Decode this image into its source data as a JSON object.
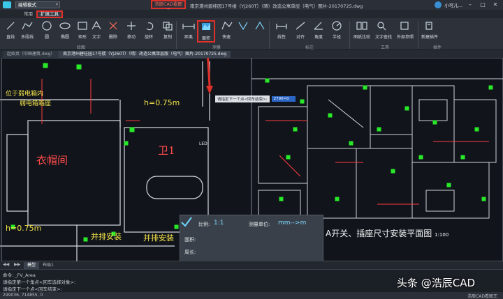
{
  "titlebar": {
    "mode": "编辑模式",
    "highlight": "浩辰CAD看图王",
    "document_title": "南京港州碧桂园17号楼（YJ260T）（晴）改造公寓单层（电气）图片-20170725.dwg",
    "user": "小可儿..."
  },
  "tabs": [
    {
      "label": "常用"
    },
    {
      "label": "扩展工具"
    }
  ],
  "ribbon": {
    "buttons": [
      {
        "label": "直线",
        "icon": "line-icon"
      },
      {
        "label": "多段线",
        "icon": "polyline-icon"
      },
      {
        "label": "圆",
        "icon": "circle-icon"
      },
      {
        "label": "椭圆",
        "icon": "ellipse-icon"
      },
      {
        "label": "矩形",
        "icon": "rectangle-icon"
      },
      {
        "label": "文字",
        "icon": "text-icon"
      },
      {
        "label": "删除",
        "icon": "delete-icon"
      },
      {
        "label": "移动",
        "icon": "move-icon"
      },
      {
        "label": "旋转",
        "icon": "rotate-icon"
      },
      {
        "label": "复制",
        "icon": "copy-icon"
      },
      {
        "label": "距离",
        "icon": "distance-icon"
      },
      {
        "label": "面积",
        "icon": "area-icon"
      },
      {
        "label": "快速",
        "icon": "quick-icon"
      },
      {
        "label": "线性",
        "icon": "linear-dim-icon"
      },
      {
        "label": "对齐",
        "icon": "aligned-dim-icon"
      },
      {
        "label": "角度",
        "icon": "angle-dim-icon"
      },
      {
        "label": "半径",
        "icon": "radius-dim-icon"
      },
      {
        "label": "图纸比较",
        "icon": "compare-icon"
      },
      {
        "label": "文字查找",
        "icon": "text-search-icon"
      },
      {
        "label": "外部参照",
        "icon": "xref-icon"
      },
      {
        "label": "新建插件",
        "icon": "plugin-icon"
      }
    ],
    "groups": [
      {
        "label": "绘图"
      },
      {
        "label": "测量"
      },
      {
        "label": "标注"
      },
      {
        "label": "工具"
      },
      {
        "label": "插件"
      }
    ]
  },
  "doc_tabs": [
    {
      "label": "起始页（中国建筑.dwg）"
    },
    {
      "label": "南京港州碧桂园17号楼（YJ260T）（晴）改造公寓单层版（电气）图片-20170725.dwg"
    }
  ],
  "drawing": {
    "rooms": [
      {
        "label": "衣帽间"
      },
      {
        "label": "卫1"
      }
    ],
    "texts": [
      "位于弱电箱内",
      "弱电箱箱座",
      "h=0.75m",
      "h=0.75m",
      "并排安装",
      "并排安装",
      "LED"
    ],
    "prompt": {
      "text": "请指定下一个点<回车结束>:",
      "value": "2790=0"
    },
    "measure": {
      "scale_label": "比例:",
      "scale_value": "1:1",
      "unit_label": "测量单位:",
      "unit_value": "mm-->m",
      "area_label": "面积:",
      "perimeter_label": "周长:"
    },
    "plan_title": "A开关、插座尺寸安装平面图",
    "plan_scale": "1:100"
  },
  "layout_tabs": [
    {
      "label": "模型"
    },
    {
      "label": "布局1"
    }
  ],
  "command": {
    "lines": [
      "命令: _FV_Area",
      "请指定第一个角点<回车选择对象>:",
      "请指定下一个点<回车结束>:"
    ]
  },
  "status": {
    "coords": "299036, 714855, 0",
    "brand": "浩辰CAD看图王"
  },
  "watermark": "头条 @浩辰CAD",
  "colors": {
    "highlight": "#e0302a",
    "cad_green": "#29e829",
    "cad_yellow": "#f2e24a",
    "cad_red": "#ff4a4a",
    "background": "#11151b"
  }
}
